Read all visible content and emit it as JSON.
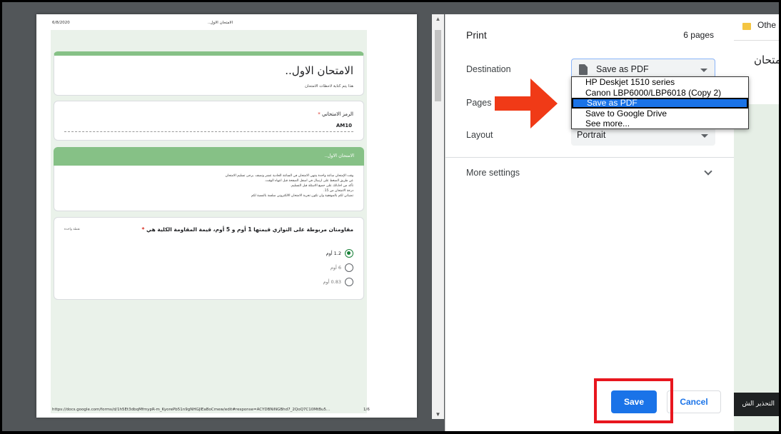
{
  "preview": {
    "header_date": "6/8/2020",
    "header_title": "..الامتحان الاول",
    "footer_url": "https://docs.google.com/forms/d/1h5Et3dbqMfmypR-m_KyorePb51n9gNHGJlEaBoCmew/edit#response=ACYDBNiNGBhd7_2QoQ7C10MtBu5...",
    "footer_page": "1/6",
    "form_title": "الامتحان الاول..",
    "form_subtitle": "هذا يتم كتابة لاحظات الامتحان",
    "code_label": "الرمز الامتحاني",
    "required_mark": "*",
    "code_answer": "AM10",
    "section_title": "الامتحان الاول..",
    "section_desc": [
      "وقت الإمتحان ساعة واحدة ينتهي الامتحان في الساعة الحادية عشر ونصف. يرجى تسليم الامتحان",
      "عن طريق الضغط على ارسال في اسفل الصفحة قبل انتهاء الوقت.",
      "تأكد من اجاباتك على جميع الاسئلة قبل التسليم.",
      "درجة الامتحان من 15.",
      "تمنياتي لكم بالموفقية وان تكون تجربة الامتحان الالكتروني سلسة بالنسبة لكم"
    ],
    "question": "مقاومتان مربوطة على التوازي قيمتها 1 أوم و 5 أوم، قيمة المقاومة الكلية هي",
    "points": "نقطة واحدة",
    "options": [
      {
        "label": "1.2 أوم",
        "selected": true
      },
      {
        "label": "6 أوم",
        "selected": false
      },
      {
        "label": "0.83 أوم",
        "selected": false
      }
    ]
  },
  "scrollbar": {
    "up_arrow": "▲",
    "down_arrow": "▼"
  },
  "dialog": {
    "title": "Print",
    "pages_count": "6 pages",
    "destination_label": "Destination",
    "destination_value": "Save as PDF",
    "pages_label": "Pages",
    "layout_label": "Layout",
    "layout_value": "Portrait",
    "more_settings": "More settings",
    "save_button": "Save",
    "cancel_button": "Cancel"
  },
  "destination_dropdown": {
    "options": [
      "HP Deskjet 1510 series",
      "Canon LBP6000/LBP6018 (Copy 2)",
      "Save as PDF",
      "Save to Google Drive",
      "See more..."
    ],
    "selected": "Save as PDF"
  },
  "browser": {
    "bookmark_other": "Othe",
    "page_title_fragment": "امتحان",
    "toast_text": "التحذير الش"
  },
  "colors": {
    "accent_blue": "#1a73e8",
    "annotation_red": "#e8161e",
    "arrow_orange": "#f03a17",
    "form_green": "#86c186"
  }
}
